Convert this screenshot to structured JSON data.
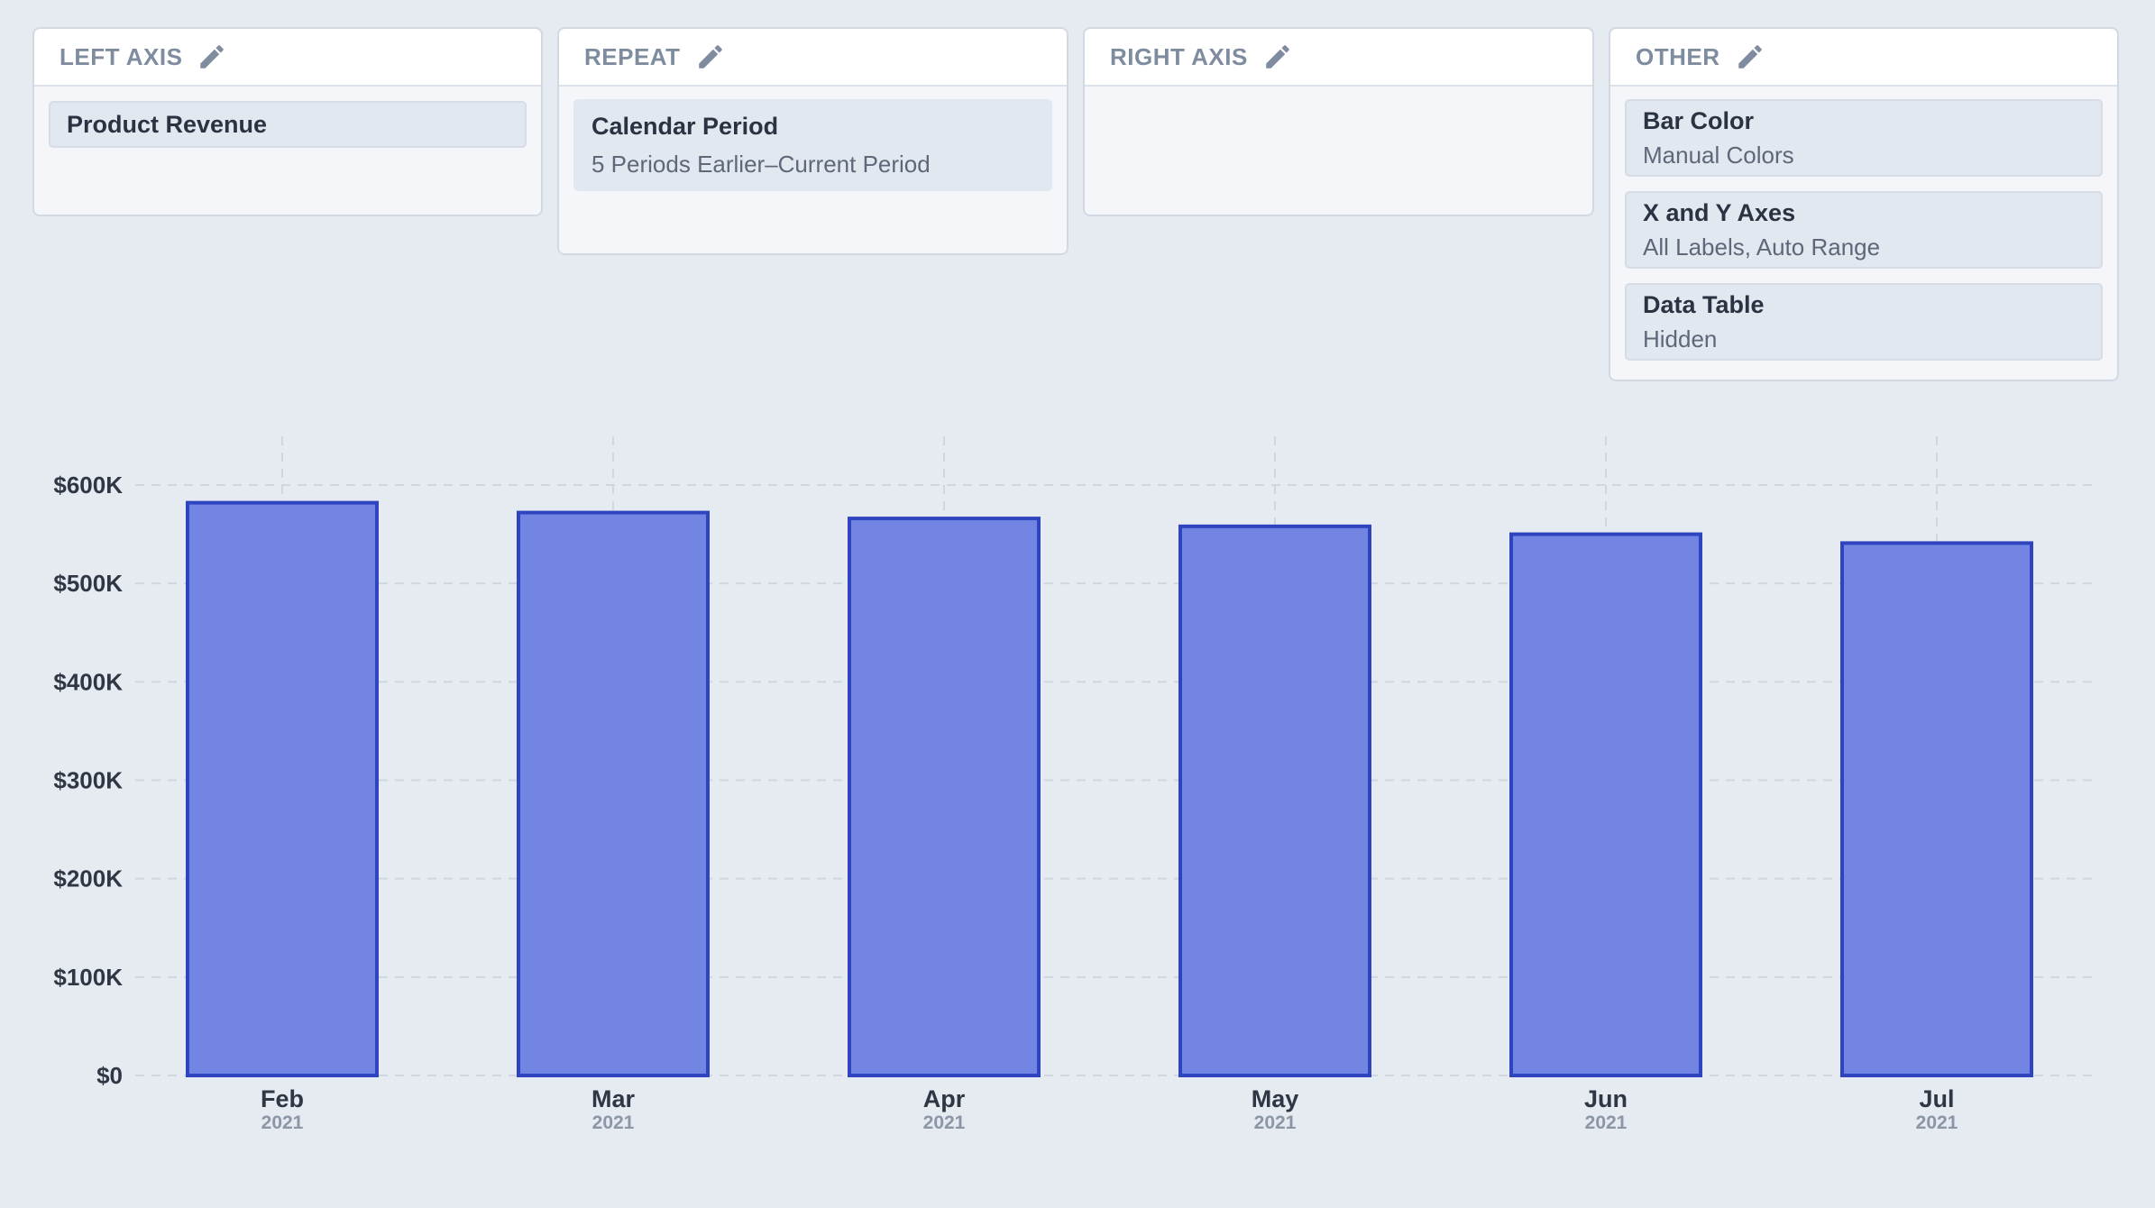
{
  "panels": {
    "left_axis": {
      "header": "LEFT AXIS",
      "items": [
        {
          "title": "Product Revenue"
        }
      ]
    },
    "repeat": {
      "header": "REPEAT",
      "items": [
        {
          "title": "Calendar Period",
          "subtitle": "5 Periods Earlier–Current Period"
        }
      ]
    },
    "right_axis": {
      "header": "RIGHT AXIS",
      "items": []
    },
    "other": {
      "header": "OTHER",
      "items": [
        {
          "title": "Bar Color",
          "subtitle": "Manual Colors"
        },
        {
          "title": "X and Y Axes",
          "subtitle": "All Labels, Auto Range"
        },
        {
          "title": "Data Table",
          "subtitle": "Hidden"
        }
      ]
    }
  },
  "icons": {
    "edit": "pencil-icon"
  },
  "chart_data": {
    "type": "bar",
    "categories": [
      "Feb",
      "Mar",
      "Apr",
      "May",
      "Jun",
      "Jul"
    ],
    "category_sublabels": [
      "2021",
      "2021",
      "2021",
      "2021",
      "2021",
      "2021"
    ],
    "series": [
      {
        "values": [
          582000,
          572000,
          566000,
          558000,
          550000,
          541000
        ]
      }
    ],
    "ylim": [
      0,
      600000
    ],
    "yticks": [
      0,
      100000,
      200000,
      300000,
      400000,
      500000,
      600000
    ],
    "ytick_labels": [
      "$0",
      "$100K",
      "$200K",
      "$300K",
      "$400K",
      "$500K",
      "$600K"
    ],
    "grid": true,
    "colors": {
      "bar_fill": "#7285e3",
      "bar_stroke": "#2e45bf",
      "grid": "#d0d6df"
    }
  }
}
